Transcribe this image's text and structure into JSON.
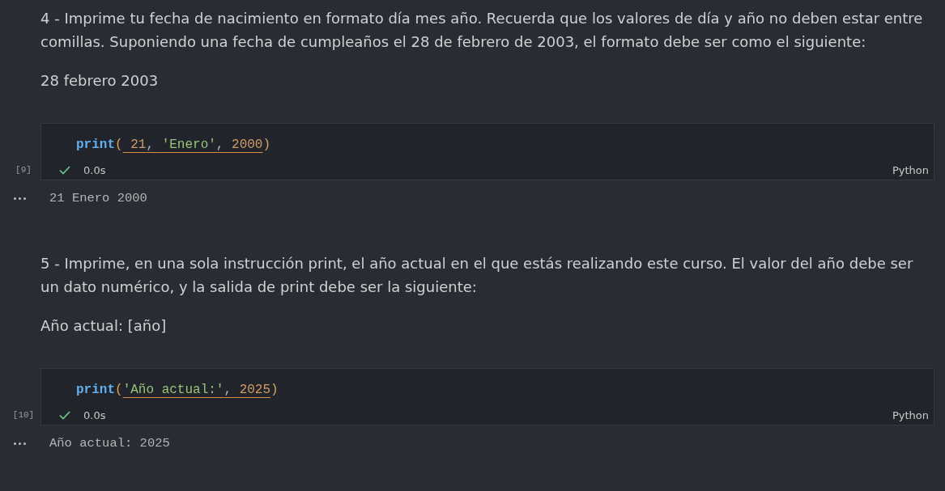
{
  "cells": [
    {
      "kind": "markdown",
      "paragraphs": [
        "4 - Imprime tu fecha de nacimiento en formato día mes año. Recuerda que los valores de día y año no deben estar entre comillas. Suponiendo una fecha de cumpleaños el 28 de febrero de 2003, el formato debe ser como el siguiente:",
        "28 febrero 2003"
      ]
    },
    {
      "kind": "code",
      "execution_count": "[9]",
      "code": {
        "function": "print",
        "open": "(",
        "args": [
          {
            "kind": "number",
            "text": " 21"
          },
          {
            "kind": "punctuation",
            "text": ", "
          },
          {
            "kind": "string",
            "text": "'Enero'"
          },
          {
            "kind": "punctuation",
            "text": ", "
          },
          {
            "kind": "number",
            "text": "2000"
          }
        ],
        "close": ")",
        "warning": true
      },
      "status": {
        "succeeded": true,
        "time": "0.0s"
      },
      "language": "Python",
      "output": "21 Enero 2000"
    },
    {
      "kind": "markdown",
      "paragraphs": [
        "5 - Imprime, en una sola instrucción print, el año actual en el que estás realizando este curso. El valor del año debe ser un dato numérico, y la salida de print debe ser la siguiente:",
        "Año actual: [año]"
      ]
    },
    {
      "kind": "code",
      "execution_count": "[10]",
      "code": {
        "function": "print",
        "open": "(",
        "args": [
          {
            "kind": "string",
            "text": "'Año actual:'"
          },
          {
            "kind": "punctuation",
            "text": ", "
          },
          {
            "kind": "number",
            "text": "2025"
          }
        ],
        "close": ")",
        "warning": true
      },
      "status": {
        "succeeded": true,
        "time": "0.0s"
      },
      "language": "Python",
      "output": "Año actual: 2025"
    }
  ]
}
